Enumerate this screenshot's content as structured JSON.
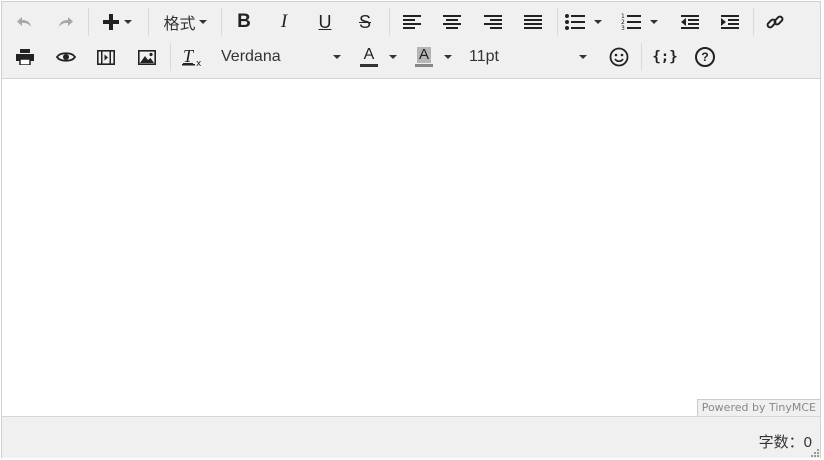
{
  "toolbar": {
    "undo_icon": "undo-icon",
    "redo_icon": "redo-icon",
    "insert_icon": "plus-icon",
    "format_label": "格式",
    "bold_label": "B",
    "italic_label": "I",
    "underline_label": "U",
    "strike_label": "S",
    "font_family": "Verdana",
    "font_size": "11pt",
    "text_color_label": "A",
    "bg_color_label": "A",
    "code_label": "{;}",
    "help_label": "?"
  },
  "branding": {
    "powered_by": "Powered by TinyMCE"
  },
  "status": {
    "wordcount": "字数：0"
  },
  "colors": {
    "toolbar_bg": "#f0f0f0",
    "text_color_bar": "#333333",
    "bg_color_swatch": "#888888"
  }
}
